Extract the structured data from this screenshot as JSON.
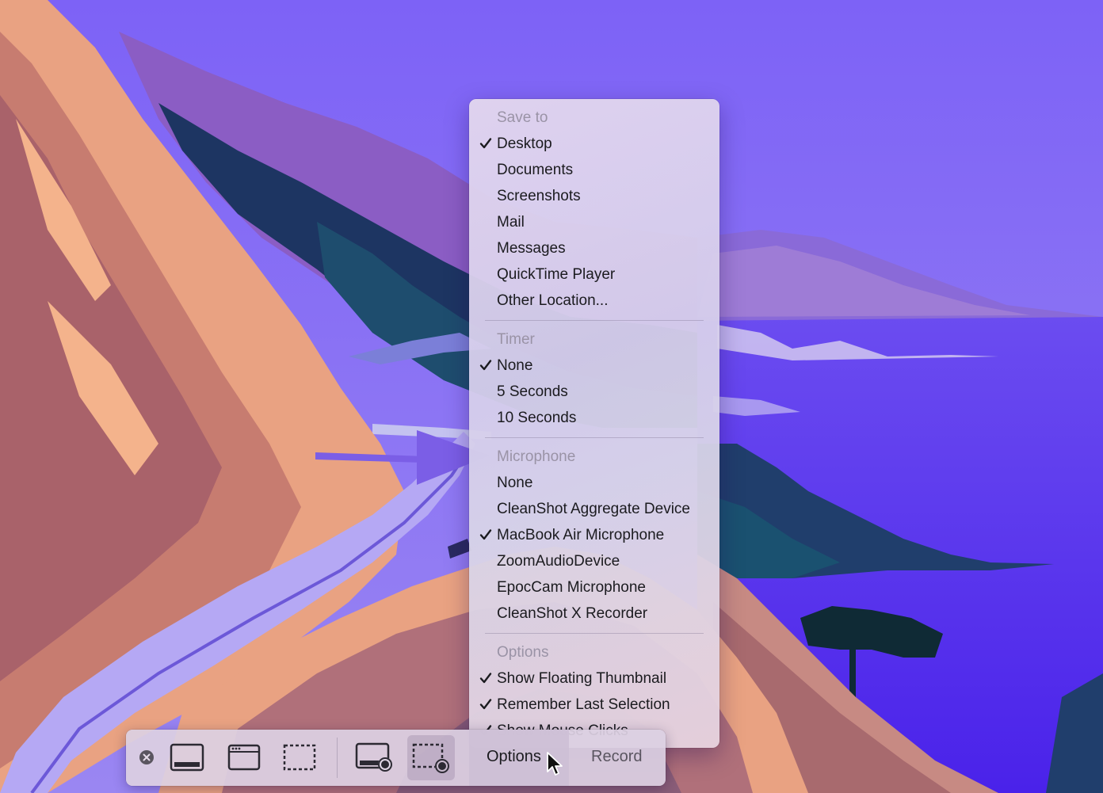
{
  "menu": {
    "sections": [
      {
        "header": "Save to",
        "items": [
          {
            "label": "Desktop",
            "checked": true
          },
          {
            "label": "Documents",
            "checked": false
          },
          {
            "label": "Screenshots",
            "checked": false
          },
          {
            "label": "Mail",
            "checked": false
          },
          {
            "label": "Messages",
            "checked": false
          },
          {
            "label": "QuickTime Player",
            "checked": false
          },
          {
            "label": "Other Location...",
            "checked": false
          }
        ]
      },
      {
        "header": "Timer",
        "items": [
          {
            "label": "None",
            "checked": true
          },
          {
            "label": "5 Seconds",
            "checked": false
          },
          {
            "label": "10 Seconds",
            "checked": false
          }
        ]
      },
      {
        "header": "Microphone",
        "items": [
          {
            "label": "None",
            "checked": false
          },
          {
            "label": "CleanShot Aggregate Device",
            "checked": false
          },
          {
            "label": "MacBook Air Microphone",
            "checked": true
          },
          {
            "label": "ZoomAudioDevice",
            "checked": false
          },
          {
            "label": "EpocCam Microphone",
            "checked": false
          },
          {
            "label": "CleanShot X Recorder",
            "checked": false
          }
        ]
      },
      {
        "header": "Options",
        "items": [
          {
            "label": "Show Floating Thumbnail",
            "checked": true
          },
          {
            "label": "Remember Last Selection",
            "checked": true
          },
          {
            "label": "Show Mouse Clicks",
            "checked": true
          }
        ]
      }
    ]
  },
  "toolbar": {
    "options_label": "Options",
    "record_label": "Record",
    "icons": [
      "close-icon",
      "capture-entire-screen-icon",
      "capture-window-icon",
      "capture-selection-icon",
      "record-entire-screen-icon",
      "record-selection-icon"
    ]
  },
  "colors": {
    "annotation_arrow": "#7b5ee6",
    "check": "#1b1b1f",
    "header_text": "#9a93a6"
  }
}
